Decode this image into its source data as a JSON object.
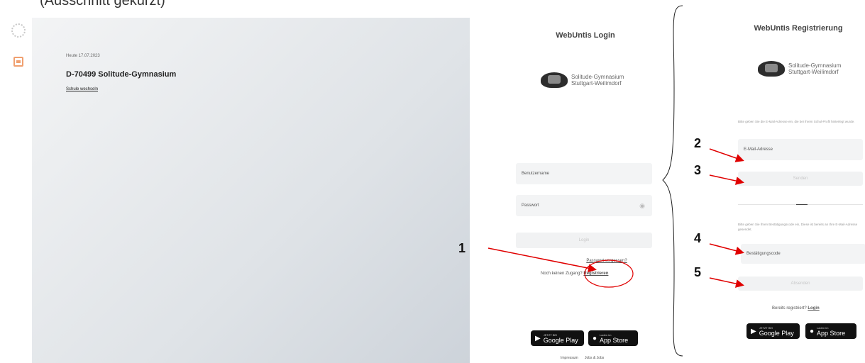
{
  "caption": "(Ausschnitt gekürzt)",
  "hero": {
    "date": "Heute 17.07.2023",
    "school_name": "D-70499 Solitude-Gymnasium",
    "change_school": "Schule wechseln"
  },
  "login": {
    "title": "WebUntis Login",
    "logo_line1": "Solitude-Gymnasium",
    "logo_line2": "Stuttgart-Weilimdorf",
    "username_placeholder": "Benutzername",
    "password_placeholder": "Passwort",
    "login_button": "Login",
    "forgot_password": "Passwort vergessen?",
    "no_access": "Noch keinen Zugang?",
    "register_link": "Registrieren",
    "google_play_small": "JETZT BEI",
    "google_play": "Google Play",
    "app_store_small": "Laden im",
    "app_store": "App Store",
    "imprint": "Impressum",
    "privacy": "Jobs & Jobs"
  },
  "register": {
    "title": "WebUntis Registrierung",
    "logo_line1": "Solitude-Gymnasium",
    "logo_line2": "Stuttgart-Weilimdorf",
    "email_hint": "Bitte geben Sie die E-Mail-Adresse ein, die bei Ihrem Schul-Profil hinterlegt wurde.",
    "email_placeholder": "E-Mail-Adresse",
    "send_button": "Senden",
    "code_hint": "Bitte geben Sie Ihren Bestätigungscode ein, Diese ist bereits an Ihre E-Mail-Adresse gesendet.",
    "code_placeholder": "Bestätigungscode",
    "submit_button": "Absenden",
    "already_registered": "Bereits registriert?",
    "login_link": "Login",
    "google_play_small": "JETZT BEI",
    "google_play": "Google Play",
    "app_store_small": "Laden im",
    "app_store": "App Store"
  },
  "annotations": {
    "n1": "1",
    "n2": "2",
    "n3": "3",
    "n4": "4",
    "n5": "5",
    "color": "#e00000"
  }
}
